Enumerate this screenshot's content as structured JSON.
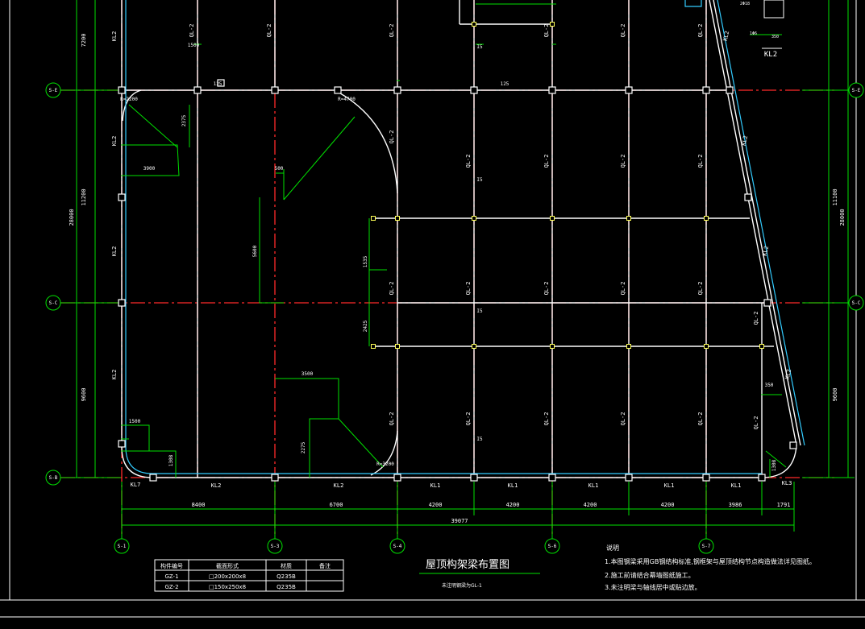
{
  "colors": {
    "background": "#000000",
    "beam": "#ffffff",
    "axis": "#ff2a2a",
    "dimension": "#00e000",
    "edge": "#33ccff",
    "node": "#ffffff",
    "sub_node": "#ffff55"
  },
  "drawing": {
    "title": "屋顶构架梁布置图",
    "subtitle": "未注明钢梁为GL-1",
    "total_dim": "39077",
    "bottom_dims": [
      "8400",
      "6700",
      "4200",
      "4200",
      "4200",
      "4200",
      "3986",
      "1791"
    ],
    "left_dims": [
      "7200",
      "11200",
      "9600",
      "28000"
    ],
    "right_dims": [
      "11100",
      "9600",
      "28000"
    ],
    "col_axes": [
      "S-1",
      "S-3",
      "S-4",
      "S-6",
      "S-7"
    ],
    "row_axes": [
      "S-E",
      "S-C",
      "S-B"
    ],
    "bottom_beams": [
      "KL7",
      "KL2",
      "KL2",
      "KL1",
      "KL1",
      "KL1",
      "KL1",
      "KL1",
      "KL3"
    ],
    "left_beams": [
      "KL2",
      "KL2",
      "KL2",
      "KL2"
    ],
    "right_beams": [
      "KL2",
      "KL2",
      "KL2",
      "KL2"
    ],
    "ql_label": "QL-2",
    "gl_label": "GL-1",
    "small_labels": [
      "125",
      "125",
      "I5",
      "I5",
      "I5",
      "I5"
    ],
    "radius_labels": [
      "R=2200",
      "R=4700",
      "R=3200"
    ],
    "detail_dims": [
      "2375",
      "3900",
      "500",
      "5600",
      "1535",
      "2425",
      "3500",
      "2275",
      "1500",
      "1308",
      "1308",
      "350",
      "1500"
    ],
    "detail_label": "KL2",
    "detail_dims_small": [
      "2Φ18",
      "350",
      "1Φ6"
    ],
    "notes_title": "说明",
    "notes": [
      "1.本图钢梁采用GB钢结构标准,钢框架与屋顶结构节点构造做法详见图纸。",
      "2.施工前请结合幕墙图纸施工。",
      "3.未注明梁与轴线居中或贴边放。"
    ],
    "table": {
      "headers": [
        "构件编号",
        "截面形式",
        "材质",
        "备注"
      ],
      "rows": [
        [
          "GZ-1",
          "□200x200x8",
          "Q235B",
          ""
        ],
        [
          "GZ-2",
          "□150x250x8",
          "Q235B",
          ""
        ]
      ]
    }
  }
}
